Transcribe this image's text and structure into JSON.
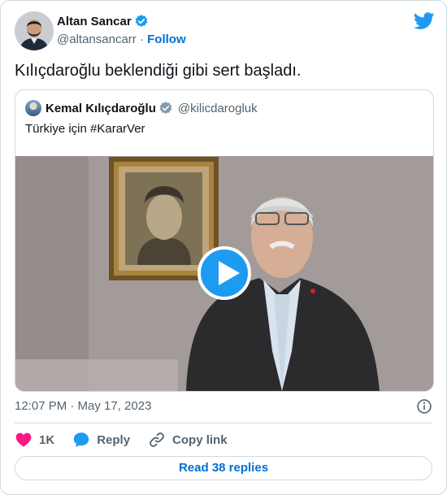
{
  "author": {
    "name": "Altan Sancar",
    "handle": "@altansancarr",
    "separator": "·",
    "follow_label": "Follow"
  },
  "tweet": {
    "text": "Kılıçdaroğlu beklendiği gibi sert başladı.",
    "timestamp": "12:07 PM · May 17, 2023"
  },
  "quoted": {
    "name": "Kemal Kılıçdaroğlu",
    "handle": "@kilicdarogluk",
    "text": "Türkiye için #KararVer"
  },
  "actions": {
    "like_count": "1K",
    "reply_label": "Reply",
    "copy_label": "Copy link"
  },
  "footer": {
    "read_replies_label": "Read 38 replies"
  },
  "colors": {
    "brand_blue": "#1d9bf0",
    "link_blue": "#006fd6",
    "like_red": "#f91880",
    "text_secondary": "#536471",
    "border": "#cfd9de"
  },
  "icons": [
    "verified-badge-icon",
    "twitter-bird-icon",
    "play-icon",
    "info-icon",
    "heart-icon",
    "reply-bubble-icon",
    "link-icon"
  ]
}
